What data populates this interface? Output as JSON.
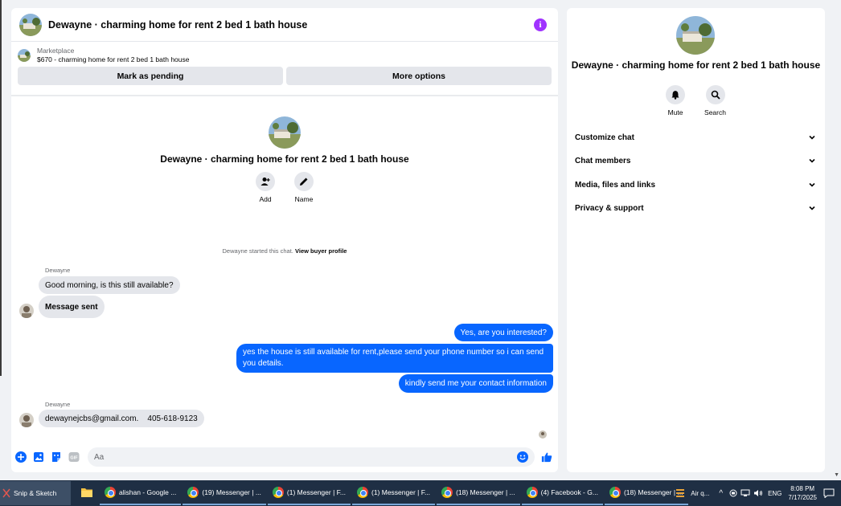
{
  "chat": {
    "title": "Dewayne · charming home for rent 2 bed 1 bath house",
    "marketplace_label": "Marketplace",
    "listing": "$670 - charming home for rent 2 bed 1 bath house",
    "mark_pending": "Mark as pending",
    "more_options": "More options",
    "profile_name": "Dewayne · charming home for rent 2 bed 1 bath house",
    "add_label": "Add",
    "name_label": "Name",
    "started_text": "Dewayne started this chat.",
    "view_buyer": "View buyer profile",
    "sender_1": "Dewayne",
    "msg_in_1": "Good morning, is this still available?",
    "msg_in_2": "Message sent",
    "msg_out_1": "Yes, are you interested?",
    "msg_out_2": "yes the house is still available for rent,please send your phone number so i can send you details.",
    "msg_out_3": "kindly send me your contact information",
    "sender_2": "Dewayne",
    "msg_in_3": "dewaynejcbs@gmail.com.    405-618-9123",
    "composer_placeholder": "Aa"
  },
  "side": {
    "name": "Dewayne · charming home for rent 2 bed 1 bath house",
    "mute": "Mute",
    "search": "Search",
    "sections": [
      "Customize chat",
      "Chat members",
      "Media, files and links",
      "Privacy & support"
    ]
  },
  "taskbar": {
    "snip": "Snip & Sketch",
    "items": [
      "alishan - Google ...",
      "(19) Messenger | ...",
      "(1) Messenger | F...",
      "(1) Messenger | F...",
      "(18) Messenger | ...",
      "(4) Facebook - G...",
      "(18) Messenger | ..."
    ],
    "weather": "Air q...",
    "lang": "ENG",
    "time": "8:08 PM",
    "date": "7/17/2025"
  },
  "colors": {
    "accent": "#0866ff",
    "info": "#a033ff",
    "taskbar": "#1f2f44"
  }
}
